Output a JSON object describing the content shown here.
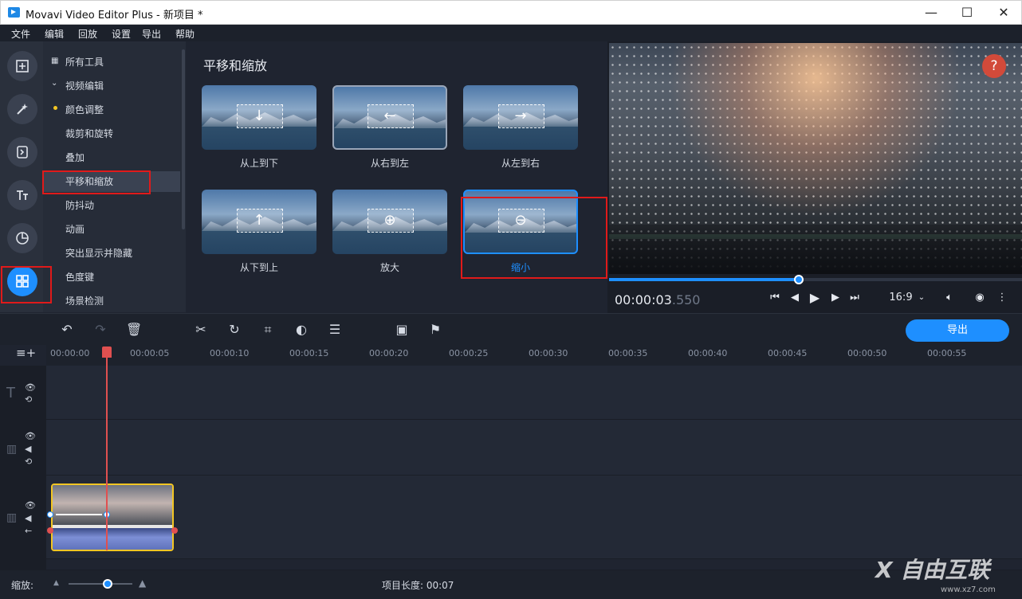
{
  "window": {
    "title": "Movavi Video Editor Plus - 新项目 *",
    "controls": [
      "—",
      "☐",
      "✕"
    ]
  },
  "menu": [
    "文件",
    "编辑",
    "回放",
    "设置",
    "导出",
    "帮助"
  ],
  "left_tools": [
    "import-icon",
    "magic-wand-icon",
    "transition-icon",
    "titles-icon",
    "filters-icon",
    "more-tools-icon"
  ],
  "tool_panel": {
    "items": [
      {
        "label": "所有工具"
      },
      {
        "label": "视频编辑"
      },
      {
        "label": "颜色调整"
      },
      {
        "label": "裁剪和旋转"
      },
      {
        "label": "叠加"
      },
      {
        "label": "平移和缩放"
      },
      {
        "label": "防抖动"
      },
      {
        "label": "动画"
      },
      {
        "label": "突出显示并隐藏"
      },
      {
        "label": "色度键"
      },
      {
        "label": "场景检测"
      }
    ],
    "selected": "平移和缩放"
  },
  "content": {
    "title": "平移和缩放",
    "effects": [
      {
        "label": "从上到下",
        "arrow": "↓"
      },
      {
        "label": "从右到左",
        "arrow": "←"
      },
      {
        "label": "从左到右",
        "arrow": "→"
      },
      {
        "label": "从下到上",
        "arrow": "↑"
      },
      {
        "label": "放大",
        "arrow": "⊕"
      },
      {
        "label": "缩小",
        "arrow": "⊖"
      }
    ],
    "selected": "缩小"
  },
  "preview": {
    "help": "?",
    "timecode_main": "00:00:03",
    "timecode_ms": ".550",
    "aspect": "16:9",
    "progress": 0.46
  },
  "toolbar": {
    "export_label": "导出"
  },
  "timeline": {
    "ticks": [
      "00:00:00",
      "00:00:05",
      "00:00:10",
      "00:00:15",
      "00:00:20",
      "00:00:25",
      "00:00:30",
      "00:00:35",
      "00:00:40",
      "00:00:45",
      "00:00:50",
      "00:00:55"
    ]
  },
  "status": {
    "zoom_label": "缩放:",
    "project_length": "项目长度: 00:07"
  },
  "watermark": {
    "text": "X 自由互联",
    "sub": "www.xz7.com"
  },
  "colors": {
    "accent": "#1e8fff",
    "highlight": "#e01a1a",
    "clip_border": "#f3c623"
  }
}
